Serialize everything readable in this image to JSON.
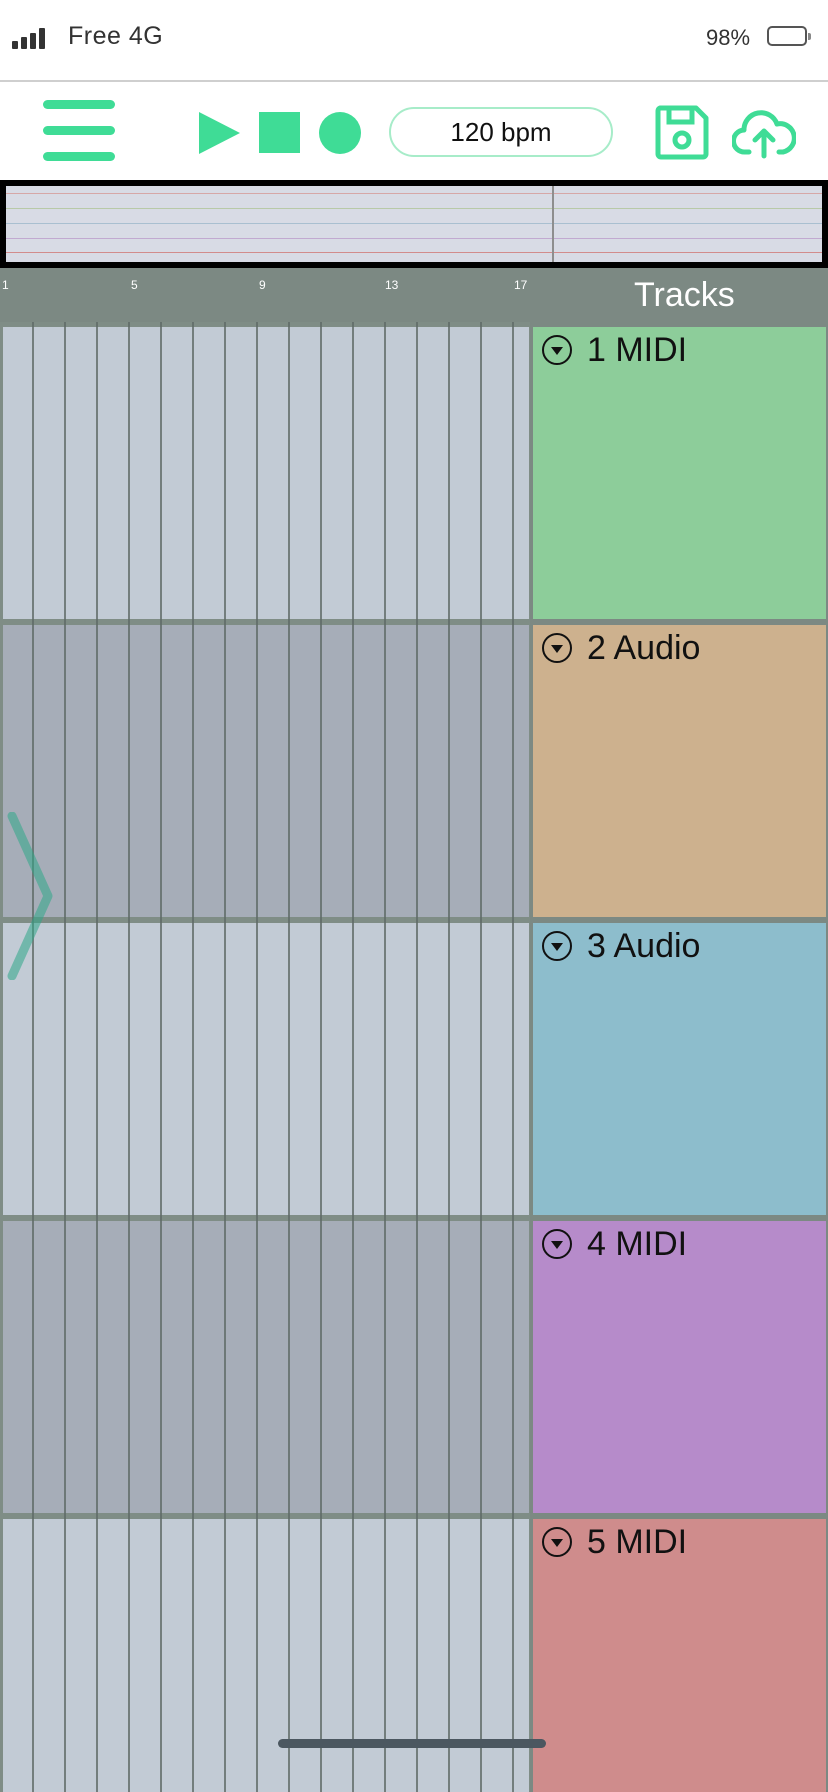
{
  "status_bar": {
    "carrier": "Free  4G",
    "battery_percent": "98%"
  },
  "toolbar": {
    "menu_icon": "hamburger-menu-icon",
    "play_icon": "play-icon",
    "stop_icon": "stop-icon",
    "record_icon": "record-icon",
    "tempo": "120 bpm",
    "save_icon": "floppy-disk-icon",
    "upload_icon": "cloud-upload-icon",
    "accent_color": "#3fdc96"
  },
  "overview": {
    "line_colors": [
      "#d6a7a7",
      "#b8c9a8",
      "#a9bfd0",
      "#c1a9d0",
      "#d28c8c"
    ]
  },
  "ruler": {
    "bars": [
      "1",
      "5",
      "9",
      "13",
      "17"
    ],
    "panel_title": "Tracks"
  },
  "tracks": [
    {
      "name": "1 MIDI",
      "color": "#8dcd9a",
      "lane_color": "#c2cbd5"
    },
    {
      "name": "2 Audio",
      "color": "#cdb18e",
      "lane_color": "#a6adb8"
    },
    {
      "name": "3 Audio",
      "color": "#8dbdcc",
      "lane_color": "#c2cbd5"
    },
    {
      "name": "4 MIDI",
      "color": "#b68bca",
      "lane_color": "#a6adb8"
    },
    {
      "name": "5 MIDI",
      "color": "#cf8c8c",
      "lane_color": "#c2cbd5"
    }
  ]
}
